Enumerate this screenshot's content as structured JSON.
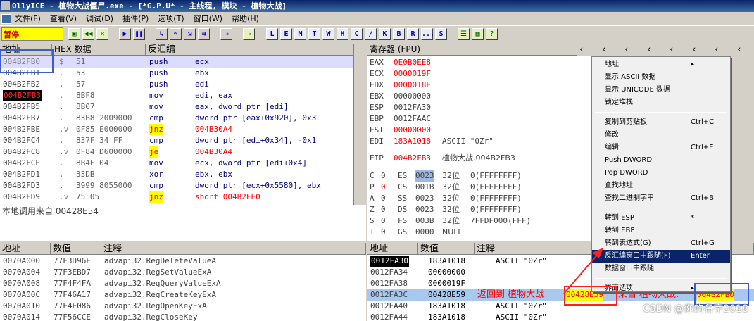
{
  "window": {
    "title": "OllyICE - 植物大战僵尸.exe - [*G.P.U* - 主线程, 模块 - 植物大战]"
  },
  "menu": [
    "文件(F)",
    "查看(V)",
    "调试(D)",
    "插件(P)",
    "选项(T)",
    "窗口(W)",
    "帮助(H)"
  ],
  "toolbar": {
    "status": "暂停",
    "letters": [
      "L",
      "E",
      "M",
      "T",
      "W",
      "H",
      "C",
      "/",
      "K",
      "B",
      "R",
      "...",
      "S"
    ]
  },
  "cpu": {
    "headers": {
      "addr": "地址",
      "hex": "HEX 数据",
      "disasm": "反汇编"
    },
    "rows": [
      {
        "addr": "004B2FB0",
        "mark": "$",
        "hex": "51",
        "mn": "push",
        "op": "ecx"
      },
      {
        "addr": "004B2FB1",
        "mark": ".",
        "hex": "53",
        "mn": "push",
        "op": "ebx"
      },
      {
        "addr": "004B2FB2",
        "mark": ".",
        "hex": "57",
        "mn": "push",
        "op": "edi"
      },
      {
        "addr": "004B2FB3",
        "mark": ".",
        "hex": "8BF8",
        "mn": "mov",
        "op": "edi, eax"
      },
      {
        "addr": "004B2FB5",
        "mark": ".",
        "hex": "8B07",
        "mn": "mov",
        "op": "eax, dword ptr [edi]"
      },
      {
        "addr": "004B2FB7",
        "mark": ".",
        "hex": "83B8 2009000",
        "mn": "cmp",
        "op": "dword ptr [eax+0x920], 0x3"
      },
      {
        "addr": "004B2FBE",
        "mark": ".v",
        "hex": "0F85 E000000",
        "mn": "jnz",
        "op": "004B30A4"
      },
      {
        "addr": "004B2FC4",
        "mark": ".",
        "hex": "837F 34 FF",
        "mn": "cmp",
        "op": "dword ptr [edi+0x34], -0x1"
      },
      {
        "addr": "004B2FC8",
        "mark": ".v",
        "hex": "0F84 D600000",
        "mn": "je",
        "op": "004B30A4"
      },
      {
        "addr": "004B2FCE",
        "mark": ".",
        "hex": "8B4F 04",
        "mn": "mov",
        "op": "ecx, dword ptr [edi+0x4]"
      },
      {
        "addr": "004B2FD1",
        "mark": ".",
        "hex": "33DB",
        "mn": "xor",
        "op": "ebx, ebx"
      },
      {
        "addr": "004B2FD3",
        "mark": ".",
        "hex": "3999 8055000",
        "mn": "cmp",
        "op": "dword ptr [ecx+0x5580], ebx"
      },
      {
        "addr": "004B2FD9",
        "mark": ".v",
        "hex": "75 05",
        "mn": "jnz",
        "op": "short 004B2FE0"
      }
    ],
    "info": "本地调用来自 00428E54"
  },
  "registers": {
    "header": "寄存器 (FPU)",
    "regs": [
      {
        "n": "EAX",
        "v": "0E0B0EE8",
        "c": ""
      },
      {
        "n": "ECX",
        "v": "0000019F",
        "c": ""
      },
      {
        "n": "EDX",
        "v": "0000018E",
        "c": ""
      },
      {
        "n": "EBX",
        "v": "00000000",
        "c": ""
      },
      {
        "n": "ESP",
        "v": "0012FA30",
        "c": ""
      },
      {
        "n": "EBP",
        "v": "0012FAAC",
        "c": ""
      },
      {
        "n": "ESI",
        "v": "00000000",
        "c": ""
      },
      {
        "n": "EDI",
        "v": "183A1018",
        "c": "ASCII \"0Zr\""
      }
    ],
    "eip": {
      "n": "EIP",
      "v": "004B2FB3",
      "c": "植物大战.004B2FB3"
    },
    "flags": [
      {
        "f": "C",
        "b": "0",
        "s": "ES",
        "sv": "0023",
        "w": "32位",
        "r": "0(FFFFFFFF)"
      },
      {
        "f": "P",
        "b": "0",
        "s": "CS",
        "sv": "001B",
        "w": "32位",
        "r": "0(FFFFFFFF)"
      },
      {
        "f": "A",
        "b": "0",
        "s": "SS",
        "sv": "0023",
        "w": "32位",
        "r": "0(FFFFFFFF)"
      },
      {
        "f": "Z",
        "b": "0",
        "s": "DS",
        "sv": "0023",
        "w": "32位",
        "r": "0(FFFFFFFF)"
      },
      {
        "f": "S",
        "b": "0",
        "s": "FS",
        "sv": "003B",
        "w": "32位",
        "r": "7FFDF000(FFF)"
      },
      {
        "f": "T",
        "b": "0",
        "s": "GS",
        "sv": "0000",
        "w": "NULL",
        "r": ""
      }
    ]
  },
  "dump": {
    "headers": {
      "addr": "地址",
      "val": "数值",
      "comment": "注释"
    },
    "rows": [
      {
        "a": "0070A000",
        "v": "77F3D96E",
        "c": "advapi32.RegDeleteValueA"
      },
      {
        "a": "0070A004",
        "v": "77F3EBD7",
        "c": "advapi32.RegSetValueExA"
      },
      {
        "a": "0070A008",
        "v": "77F4F4FA",
        "c": "advapi32.RegQueryValueExA"
      },
      {
        "a": "0070A00C",
        "v": "77F46A17",
        "c": "advapi32.RegCreateKeyExA"
      },
      {
        "a": "0070A010",
        "v": "77F4E086",
        "c": "advapi32.RegOpenKeyExA"
      },
      {
        "a": "0070A014",
        "v": "77F56CCE",
        "c": "advapi32.RegCloseKey"
      }
    ]
  },
  "stack": {
    "headers": {
      "addr": "地址",
      "val": "数值",
      "comment": "注释"
    },
    "rows": [
      {
        "a": "0012FA30",
        "v": "183A1018",
        "c": "ASCII \"0Zr\""
      },
      {
        "a": "0012FA34",
        "v": "00000000",
        "c": ""
      },
      {
        "a": "0012FA38",
        "v": "0000019F",
        "c": ""
      },
      {
        "a": "0012FA3C",
        "v": "00428E59",
        "c": "返回到 植物大战 00428E59 来自 植物大战.004B2FB0"
      },
      {
        "a": "0012FA40",
        "v": "183A1018",
        "c": "ASCII \"0Zr\""
      },
      {
        "a": "0012FA44",
        "v": "183A1018",
        "c": "ASCII \"0Zr\""
      }
    ],
    "ret_text": "返回到 植物大战",
    "ret_addr": "00428E59",
    "from_text": "来自 植物大战.",
    "from_addr": "004B2FB0"
  },
  "context_menu": {
    "items": [
      {
        "label": "地址",
        "key": "▸"
      },
      {
        "label": "显示 ASCII 数据",
        "key": ""
      },
      {
        "label": "显示 UNICODE 数据",
        "key": ""
      },
      {
        "label": "锁定堆栈",
        "key": ""
      },
      {
        "label": "复制到剪贴板",
        "key": "Ctrl+C"
      },
      {
        "label": "修改",
        "key": ""
      },
      {
        "label": "编辑",
        "key": "Ctrl+E"
      },
      {
        "label": "Push DWORD",
        "key": ""
      },
      {
        "label": "Pop DWORD",
        "key": ""
      },
      {
        "label": "查找地址",
        "key": ""
      },
      {
        "label": "查找二进制字串",
        "key": "Ctrl+B"
      },
      {
        "label": "转到 ESP",
        "key": "*"
      },
      {
        "label": "转到 EBP",
        "key": ""
      },
      {
        "label": "转到表达式(G)",
        "key": "Ctrl+G"
      },
      {
        "label": "反汇编窗口中跟随(F)",
        "key": "Enter"
      },
      {
        "label": "数据窗口中跟随",
        "key": ""
      },
      {
        "label": "界面选项",
        "key": "▸"
      }
    ]
  },
  "watermark": "CSDN @你的名字2018",
  "colors": {
    "accent": "#0a246a",
    "highlight": "#ffff00",
    "red": "#ff0000",
    "annotation_box": "#3a5fcd",
    "arrow": "#ff2020"
  }
}
